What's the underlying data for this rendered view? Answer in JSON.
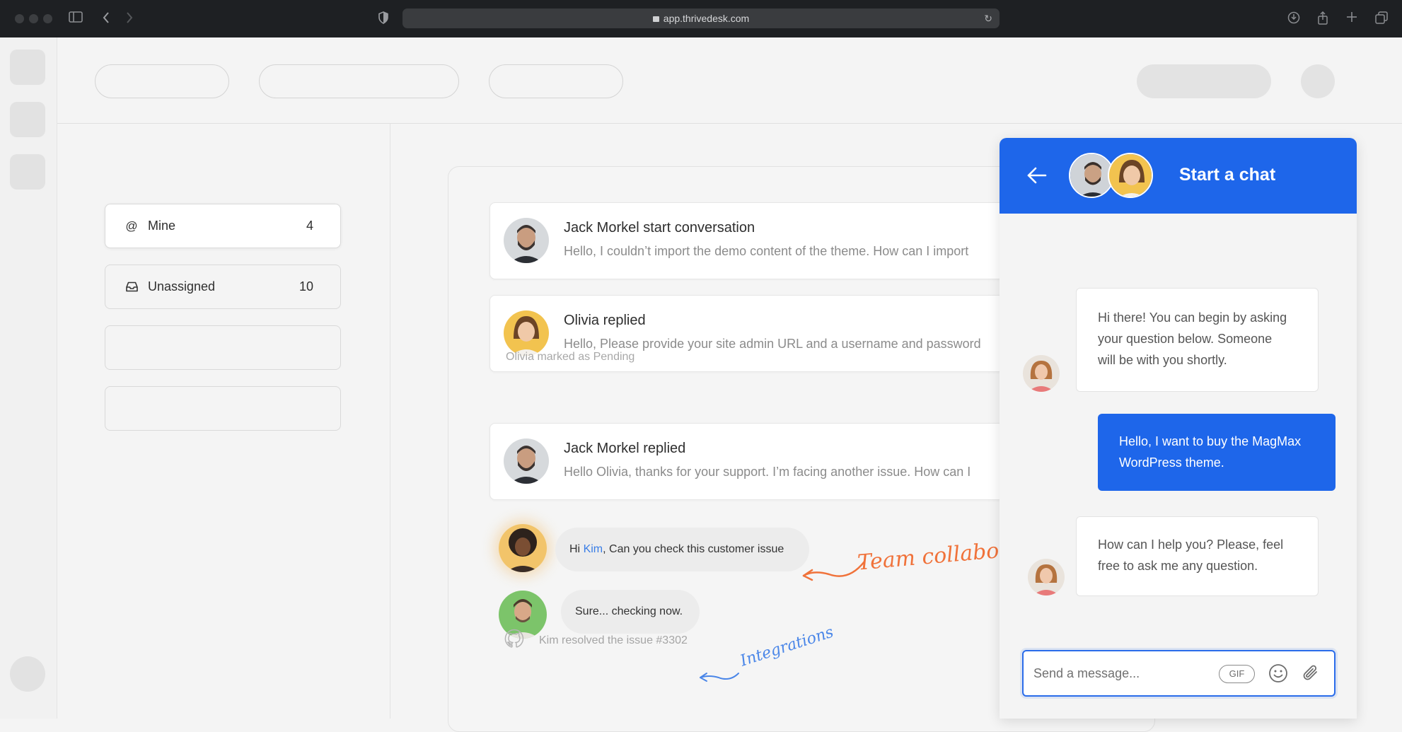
{
  "browser": {
    "url": "app.thrivedesk.com"
  },
  "sidebar": {
    "items": [
      {
        "label": "Mine",
        "count": "4",
        "icon": "at-icon"
      },
      {
        "label": "Unassigned",
        "count": "10",
        "icon": "inbox-icon"
      }
    ]
  },
  "feed": {
    "conversations": [
      {
        "title": "Jack Morkel start conversation",
        "text": "Hello, I couldn’t import the demo content of the theme. How can I import"
      },
      {
        "title": "Olivia replied",
        "text": "Hello, Please provide your site admin URL and a username and password"
      },
      {
        "title": "Jack Morkel replied",
        "text": "Hello Olivia, thanks for your support. I’m facing another issue. How can I"
      }
    ],
    "pending_note": "Olivia marked as Pending",
    "internal": {
      "msg1_prefix": "Hi ",
      "msg1_mention": "Kim",
      "msg1_suffix": ", Can you check this customer issue",
      "msg2": "Sure... checking now."
    },
    "resolved_note": "Kim resolved the issue #3302",
    "annotation_team": "Team collaborat",
    "annotation_integrations": "Integrations"
  },
  "chat": {
    "title": "Start a chat",
    "messages": [
      {
        "from": "agent",
        "lines": [
          "Hi there! You can begin by asking",
          "your question below. Someone",
          "will be with you shortly."
        ]
      },
      {
        "from": "user",
        "lines": [
          "Hello, I want to buy the MagMax",
          "WordPress theme."
        ]
      },
      {
        "from": "agent",
        "lines": [
          "How can I help you? Please, feel",
          "free to ask me any question."
        ]
      }
    ],
    "compose_placeholder": "Send a message...",
    "gif_label": "GIF"
  },
  "colors": {
    "accent": "#1e66ea",
    "annotation_orange": "#f0723a",
    "annotation_blue": "#4a86e8",
    "mention": "#3a7ee6"
  }
}
